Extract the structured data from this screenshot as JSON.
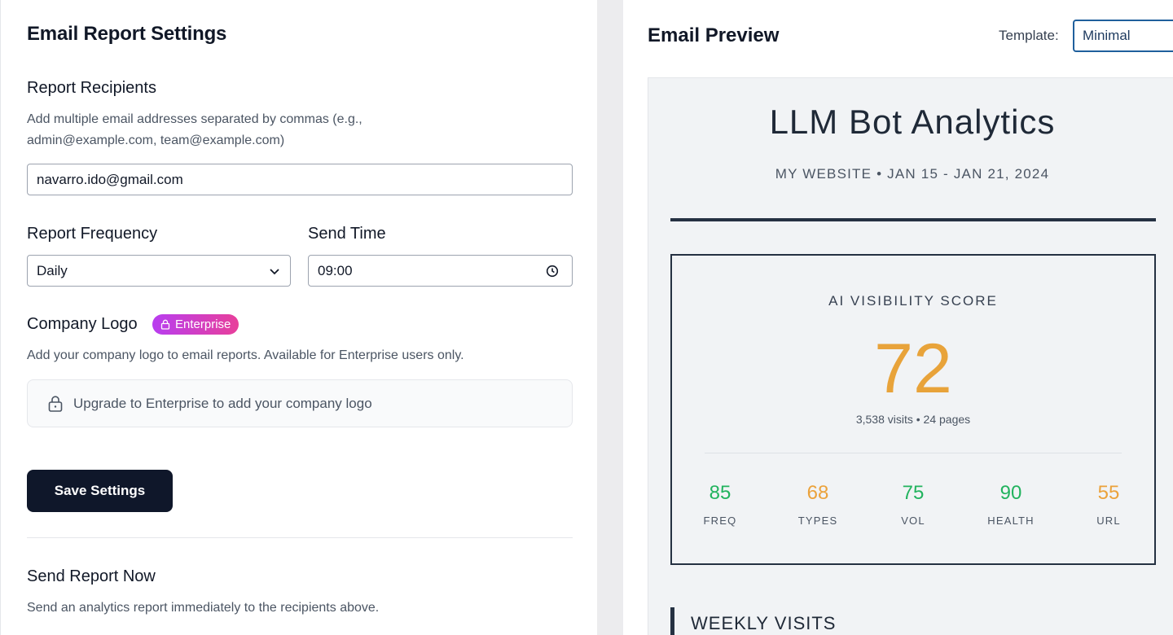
{
  "settings": {
    "title": "Email Report Settings",
    "recipients": {
      "label": "Report Recipients",
      "help_line1": "Add multiple email addresses separated by commas (e.g.,",
      "help_line2": "admin@example.com, team@example.com)",
      "value": "navarro.ido@gmail.com"
    },
    "frequency": {
      "label": "Report Frequency",
      "value": "Daily"
    },
    "send_time": {
      "label": "Send Time",
      "value": "09:00"
    },
    "logo": {
      "label": "Company Logo",
      "badge": "Enterprise",
      "help": "Add your company logo to email reports. Available for Enterprise users only.",
      "upgrade_text": "Upgrade to Enterprise to add your company logo"
    },
    "save_label": "Save Settings",
    "send_now": {
      "title": "Send Report Now",
      "help": "Send an analytics report immediately to the recipients above."
    }
  },
  "preview": {
    "title": "Email Preview",
    "template_label": "Template:",
    "template_value": "Minimal",
    "email": {
      "brand": "LLM Bot Analytics",
      "site_line": "MY WEBSITE • JAN 15 - JAN 21, 2024",
      "score_label": "AI VISIBILITY SCORE",
      "score": "72",
      "score_sub": "3,538 visits • 24 pages",
      "metrics": [
        {
          "value": "85",
          "label": "FREQ",
          "color": "#22b35e"
        },
        {
          "value": "68",
          "label": "TYPES",
          "color": "#eba23b"
        },
        {
          "value": "75",
          "label": "VOL",
          "color": "#22b35e"
        },
        {
          "value": "90",
          "label": "HEALTH",
          "color": "#22b35e"
        },
        {
          "value": "55",
          "label": "URL",
          "color": "#eba23b"
        }
      ],
      "weekly_title": "WEEKLY VISITS"
    }
  },
  "colors": {
    "score": "#e8a33a",
    "good": "#22b35e",
    "warn": "#eba23b",
    "dark": "#0f172a",
    "badge_from": "#b83ef0",
    "badge_to": "#e83f9a",
    "select_border": "#1f5f9c"
  },
  "icons": {
    "frequency_dropdown": "chevron-down-icon",
    "send_time": "clock-icon",
    "badge": "lock-icon",
    "upgrade": "lock-icon",
    "template_dropdown": "chevron-down-icon"
  }
}
